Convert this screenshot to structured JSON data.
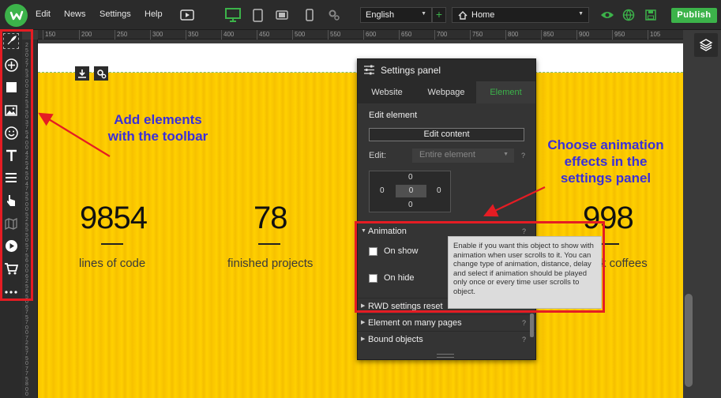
{
  "topbar": {
    "menu": [
      "Edit",
      "News",
      "Settings",
      "Help"
    ],
    "language": "English",
    "page": "Home",
    "publish_label": "Publish"
  },
  "ruler": {
    "top_ticks": [
      "150",
      "200",
      "250",
      "300",
      "350",
      "400",
      "450",
      "500",
      "550",
      "600",
      "650",
      "700",
      "750",
      "800",
      "850",
      "900",
      "950",
      "105"
    ],
    "left_digits": [
      "2",
      "5",
      "0",
      "2",
      "7",
      "5",
      "3",
      "0",
      "0",
      "3",
      "2",
      "5",
      "3",
      "5",
      "0",
      "3",
      "7",
      "5",
      "4",
      "0",
      "0",
      "4",
      "2",
      "5",
      "4",
      "5",
      "0",
      "4",
      "7",
      "5",
      "5",
      "0",
      "0",
      "5",
      "2",
      "5",
      "5",
      "5",
      "0",
      "5",
      "7",
      "5",
      "6",
      "0",
      "0",
      "6",
      "2",
      "5",
      "6",
      "5",
      "0",
      "6",
      "7",
      "5",
      "7",
      "0",
      "0",
      "7",
      "2",
      "5",
      "7",
      "5",
      "0",
      "7",
      "7",
      "5",
      "8",
      "0",
      "0"
    ]
  },
  "canvas": {
    "stats": [
      {
        "number": "9854",
        "label": "lines of code"
      },
      {
        "number": "78",
        "label": "finished projects"
      },
      {
        "number": "998",
        "label": "k coffees"
      }
    ]
  },
  "callouts": {
    "toolbar": [
      "Add elements",
      "with the toolbar"
    ],
    "panel": [
      "Choose animation",
      "effects in the",
      "settings panel"
    ]
  },
  "settings_panel": {
    "title": "Settings panel",
    "tabs": [
      "Website",
      "Webpage",
      "Element"
    ],
    "active_tab": "Element",
    "edit_element_label": "Edit element",
    "edit_content_label": "Edit content",
    "edit_label": "Edit:",
    "edit_value": "Entire element",
    "box_model": {
      "top": "0",
      "left": "0",
      "center": "0",
      "right": "0",
      "bottom": "0"
    },
    "help_mark": "?",
    "sections": {
      "animation": "Animation",
      "on_show": "On show",
      "on_hide": "On hide",
      "rwd_reset": "RWD settings reset",
      "many_pages": "Element on many pages",
      "bound_objects": "Bound objects"
    }
  },
  "tooltip": {
    "text": "Enable if you want this object to show with animation when user scrolls to it. You can change type of animation, distance, delay and select if animation should be played only once or every time user scrolls to object."
  },
  "colors": {
    "accent_green": "#3cb34a",
    "highlight_red": "#e51c23",
    "callout_blue": "#3a2fd9",
    "canvas_yellow": "#ffd000"
  }
}
